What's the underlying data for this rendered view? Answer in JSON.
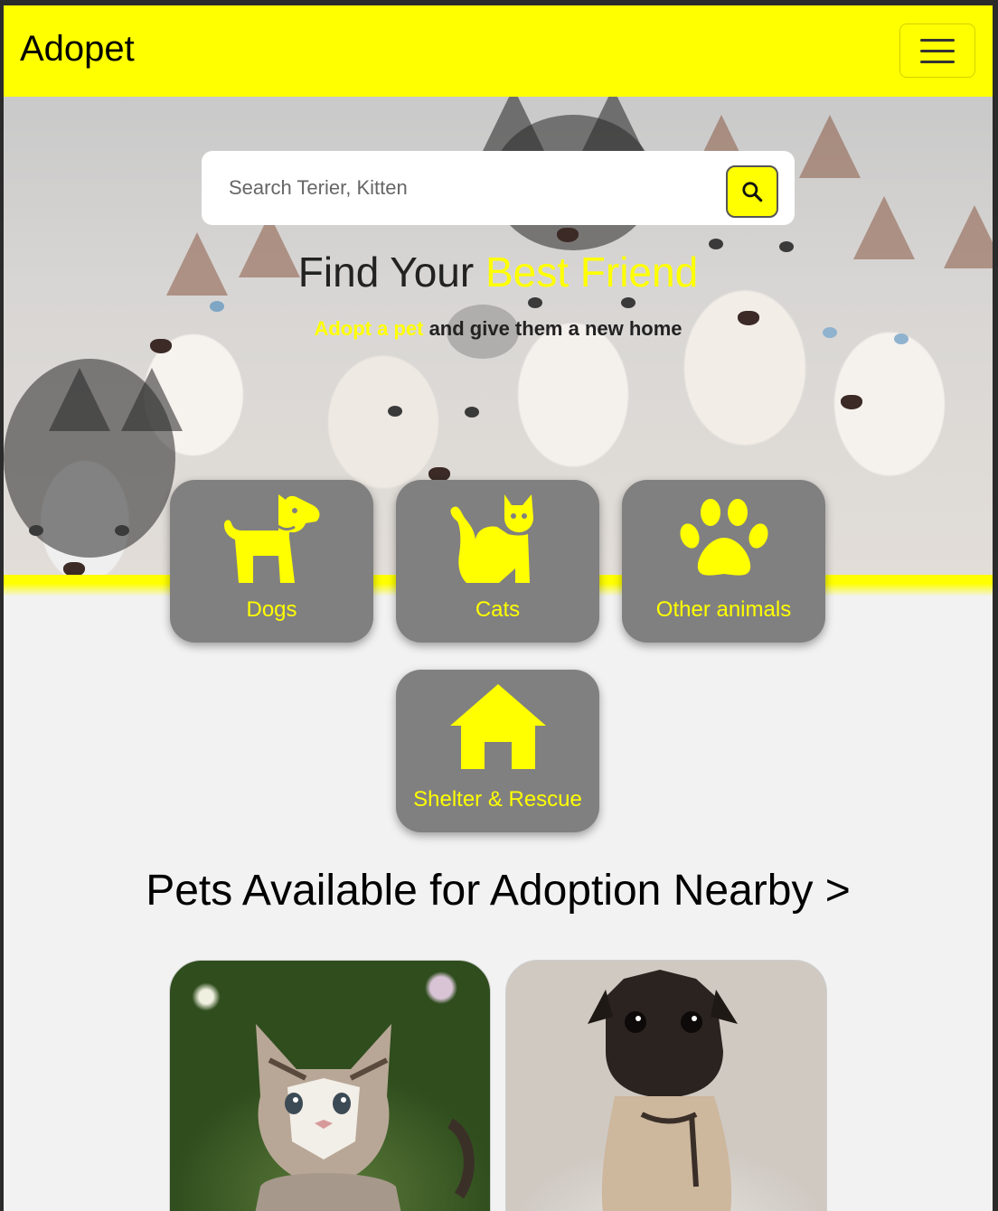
{
  "brand": "Adopet",
  "nav": {
    "menu_icon": "hamburger-menu-icon"
  },
  "search": {
    "placeholder": "Search Terier, Kitten",
    "icon": "search-icon"
  },
  "hero": {
    "title_prefix": "Find Your ",
    "title_highlight": "Best Friend",
    "subtitle_highlight": "Adopt a pet",
    "subtitle_rest": " and give them a new home"
  },
  "categories": [
    {
      "label": "Dogs",
      "icon": "dog-icon"
    },
    {
      "label": "Cats",
      "icon": "cat-icon"
    },
    {
      "label": "Other animals",
      "icon": "paw-icon"
    },
    {
      "label": "Shelter & Rescue",
      "icon": "house-icon"
    }
  ],
  "section_title": "Pets Available for Adoption Nearby >",
  "pets": [
    {
      "image": "kitten-photo"
    },
    {
      "image": "pug-photo"
    }
  ],
  "colors": {
    "accent": "#ffff00",
    "card": "#808080",
    "background": "#f2f2f2"
  }
}
